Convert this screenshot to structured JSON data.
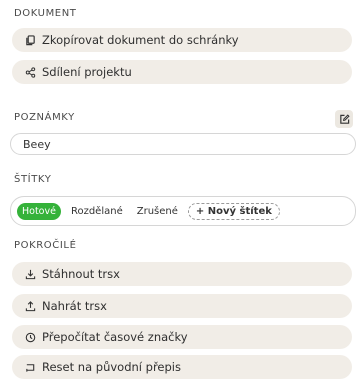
{
  "document": {
    "title": "DOKUMENT",
    "copy_label": "Zkopírovat dokument do schránky",
    "share_label": "Sdílení projektu"
  },
  "notes": {
    "title": "POZNÁMKY",
    "value": "Beey"
  },
  "tags": {
    "title": "ŠTÍTKY",
    "items": [
      "Hotové",
      "Rozdělané",
      "Zrušené"
    ],
    "new_label": "+ Nový štítek",
    "active_color": "#35b23a"
  },
  "advanced": {
    "title": "POKROČILÉ",
    "download_label": "Stáhnout trsx",
    "upload_label": "Nahrát trsx",
    "recalc_label": "Přepočítat časové značky",
    "reset_label": "Reset na původní přepis"
  }
}
